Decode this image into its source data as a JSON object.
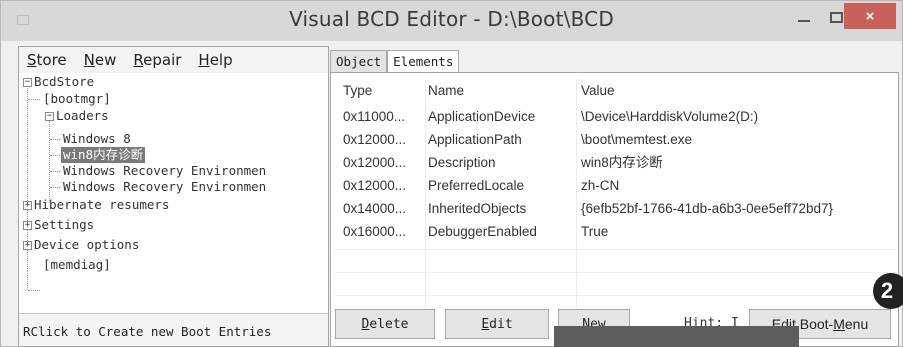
{
  "window": {
    "title": "Visual BCD Editor - D:\\Boot\\BCD",
    "controls": {
      "minimize": "–",
      "maximize": "□",
      "close": "×"
    }
  },
  "menu": {
    "items": [
      {
        "label": "Store",
        "underline": "S",
        "rest": "tore"
      },
      {
        "label": "New",
        "underline": "N",
        "rest": "ew"
      },
      {
        "label": "Repair",
        "underline": "R",
        "rest": "epair"
      },
      {
        "label": "Help",
        "underline": "H",
        "rest": "elp"
      }
    ]
  },
  "tree": {
    "root": "BcdStore",
    "bootmgr": "[bootmgr]",
    "loaders": "Loaders",
    "loader_items": [
      "Windows 8",
      "win8内存诊断",
      "Windows Recovery Environmen",
      "Windows Recovery Environmen"
    ],
    "hibernate": "Hibernate resumers",
    "settings": "Settings",
    "device_options": "Device options",
    "memdiag": "[memdiag]",
    "expander_collapsed": "+",
    "expander_expanded": "−"
  },
  "status": "RClick to Create new Boot Entries",
  "tabs": [
    "Object",
    "Elements"
  ],
  "elements": {
    "columns": [
      "Type",
      "Name",
      "Value"
    ],
    "rows": [
      {
        "type": "0x11000...",
        "name": "ApplicationDevice",
        "value": "\\Device\\HarddiskVolume2(D:)"
      },
      {
        "type": "0x12000...",
        "name": "ApplicationPath",
        "value": "\\boot\\memtest.exe"
      },
      {
        "type": "0x12000...",
        "name": "Description",
        "value": "win8内存诊断"
      },
      {
        "type": "0x12000...",
        "name": "PreferredLocale",
        "value": "zh-CN"
      },
      {
        "type": "0x14000...",
        "name": "InheritedObjects",
        "value": "{6efb52bf-1766-41db-a6b3-0ee5eff72bd7}"
      },
      {
        "type": "0x16000...",
        "name": "DebuggerEnabled",
        "value": "True"
      }
    ]
  },
  "buttons": {
    "delete": {
      "underline": "D",
      "rest": "elete"
    },
    "edit": {
      "underline": "E",
      "rest": "dit"
    },
    "new": {
      "underline": "N",
      "rest": "ew"
    },
    "edit_boot_menu": {
      "before": "Edit Boot-",
      "underline": "M",
      "rest": "enu"
    }
  },
  "hint": "Hint: I",
  "badge": "2",
  "colors": {
    "selection": "#7a7a7a",
    "close_button": "#c9605a",
    "window_bg": "#f0f0f0"
  }
}
